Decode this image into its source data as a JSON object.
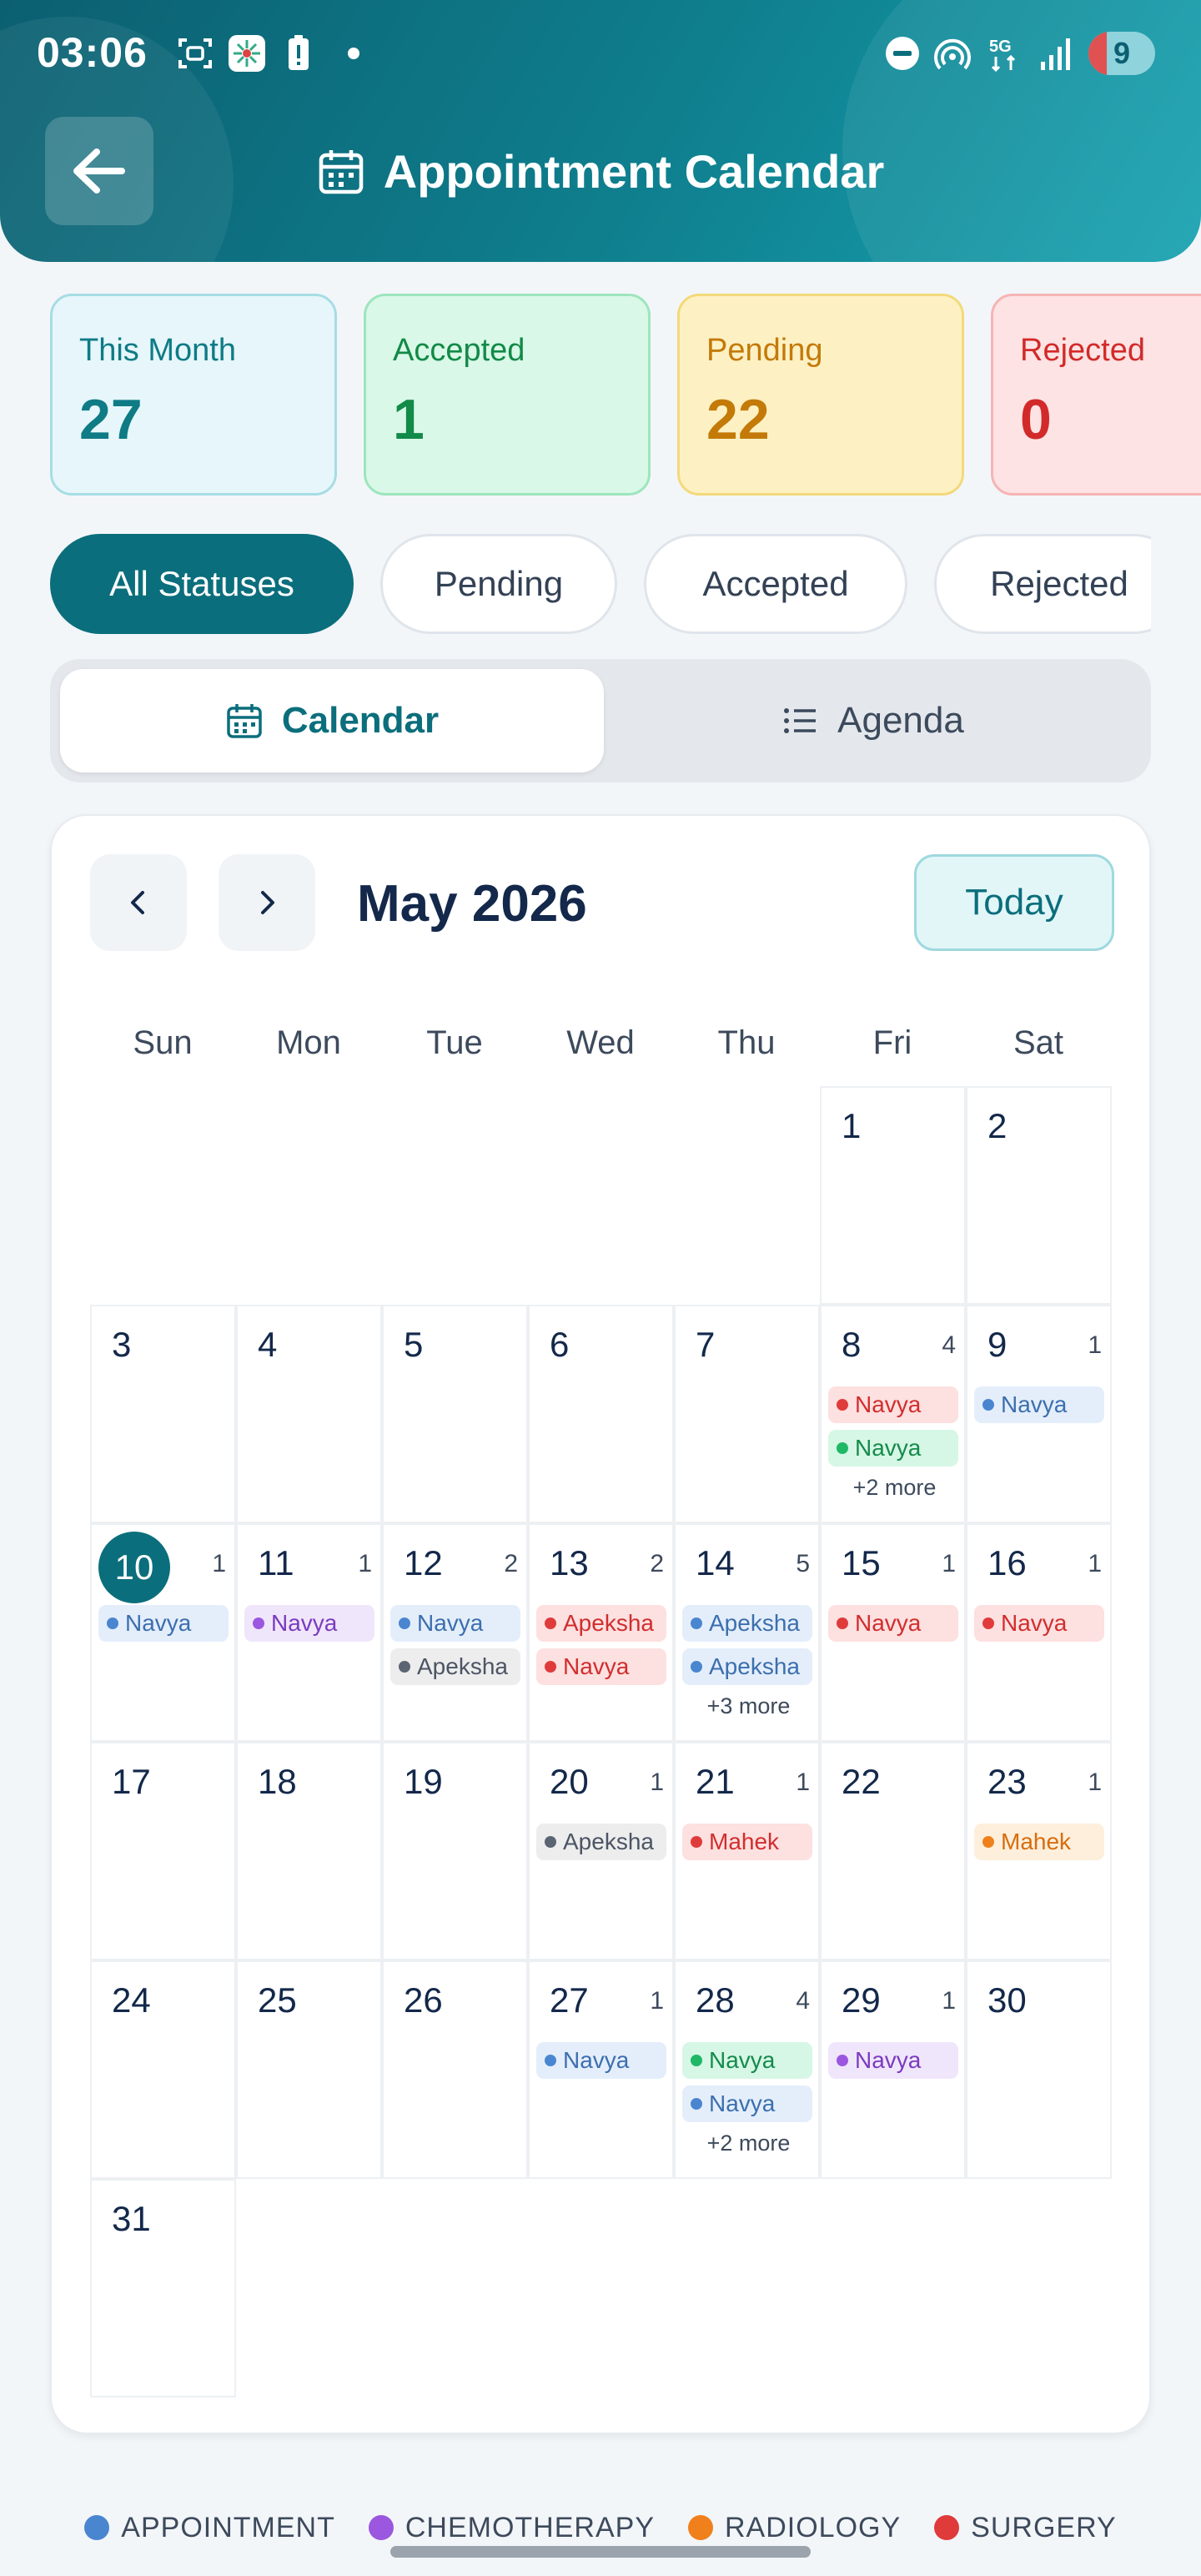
{
  "status_bar": {
    "time": "03:06",
    "battery": "9"
  },
  "header": {
    "title": "Appointment Calendar"
  },
  "stats": [
    {
      "label": "This Month",
      "value": "27"
    },
    {
      "label": "Accepted",
      "value": "1"
    },
    {
      "label": "Pending",
      "value": "22"
    },
    {
      "label": "Rejected",
      "value": "0"
    }
  ],
  "filters": [
    "All Statuses",
    "Pending",
    "Accepted",
    "Rejected"
  ],
  "view_toggle": {
    "calendar": "Calendar",
    "agenda": "Agenda"
  },
  "calendar": {
    "month": "May 2026",
    "today_label": "Today",
    "weekdays": [
      "Sun",
      "Mon",
      "Tue",
      "Wed",
      "Thu",
      "Fri",
      "Sat"
    ],
    "today": 10,
    "days": [
      {
        "day": 1,
        "count": "",
        "events": [],
        "more": ""
      },
      {
        "day": 2,
        "count": "",
        "events": [],
        "more": ""
      },
      {
        "day": 3,
        "count": "",
        "events": [],
        "more": ""
      },
      {
        "day": 4,
        "count": "",
        "events": [],
        "more": ""
      },
      {
        "day": 5,
        "count": "",
        "events": [],
        "more": ""
      },
      {
        "day": 6,
        "count": "",
        "events": [],
        "more": ""
      },
      {
        "day": 7,
        "count": "",
        "events": [],
        "more": ""
      },
      {
        "day": 8,
        "count": "4",
        "events": [
          {
            "name": "Navya",
            "color": "red"
          },
          {
            "name": "Navya",
            "color": "green"
          }
        ],
        "more": "+2 more"
      },
      {
        "day": 9,
        "count": "1",
        "events": [
          {
            "name": "Navya",
            "color": "blue"
          }
        ],
        "more": ""
      },
      {
        "day": 10,
        "count": "1",
        "events": [
          {
            "name": "Navya",
            "color": "blue"
          }
        ],
        "more": ""
      },
      {
        "day": 11,
        "count": "1",
        "events": [
          {
            "name": "Navya",
            "color": "purple"
          }
        ],
        "more": ""
      },
      {
        "day": 12,
        "count": "2",
        "events": [
          {
            "name": "Navya",
            "color": "blue"
          },
          {
            "name": "Apeksha",
            "color": "gray"
          }
        ],
        "more": ""
      },
      {
        "day": 13,
        "count": "2",
        "events": [
          {
            "name": "Apeksha",
            "color": "red"
          },
          {
            "name": "Navya",
            "color": "red"
          }
        ],
        "more": ""
      },
      {
        "day": 14,
        "count": "5",
        "events": [
          {
            "name": "Apeksha",
            "color": "blue"
          },
          {
            "name": "Apeksha",
            "color": "blue"
          }
        ],
        "more": "+3 more"
      },
      {
        "day": 15,
        "count": "1",
        "events": [
          {
            "name": "Navya",
            "color": "red"
          }
        ],
        "more": ""
      },
      {
        "day": 16,
        "count": "1",
        "events": [
          {
            "name": "Navya",
            "color": "red"
          }
        ],
        "more": ""
      },
      {
        "day": 17,
        "count": "",
        "events": [],
        "more": ""
      },
      {
        "day": 18,
        "count": "",
        "events": [],
        "more": ""
      },
      {
        "day": 19,
        "count": "",
        "events": [],
        "more": ""
      },
      {
        "day": 20,
        "count": "1",
        "events": [
          {
            "name": "Apeksha",
            "color": "gray"
          }
        ],
        "more": ""
      },
      {
        "day": 21,
        "count": "1",
        "events": [
          {
            "name": "Mahek",
            "color": "red"
          }
        ],
        "more": ""
      },
      {
        "day": 22,
        "count": "",
        "events": [],
        "more": ""
      },
      {
        "day": 23,
        "count": "1",
        "events": [
          {
            "name": "Mahek",
            "color": "orange"
          }
        ],
        "more": ""
      },
      {
        "day": 24,
        "count": "",
        "events": [],
        "more": ""
      },
      {
        "day": 25,
        "count": "",
        "events": [],
        "more": ""
      },
      {
        "day": 26,
        "count": "",
        "events": [],
        "more": ""
      },
      {
        "day": 27,
        "count": "1",
        "events": [
          {
            "name": "Navya",
            "color": "blue"
          }
        ],
        "more": ""
      },
      {
        "day": 28,
        "count": "4",
        "events": [
          {
            "name": "Navya",
            "color": "green"
          },
          {
            "name": "Navya",
            "color": "blue"
          }
        ],
        "more": "+2 more"
      },
      {
        "day": 29,
        "count": "1",
        "events": [
          {
            "name": "Navya",
            "color": "purple"
          }
        ],
        "more": ""
      },
      {
        "day": 30,
        "count": "",
        "events": [],
        "more": ""
      },
      {
        "day": 31,
        "count": "",
        "events": [],
        "more": ""
      }
    ]
  },
  "legend": [
    {
      "label": "APPOINTMENT",
      "color": "#4a86d0"
    },
    {
      "label": "CHEMOTHERAPY",
      "color": "#9b57e0"
    },
    {
      "label": "RADIOLOGY",
      "color": "#f0801b"
    },
    {
      "label": "SURGERY",
      "color": "#e03b3b"
    }
  ],
  "colors": {
    "primary": "#0b6e7c",
    "header_start": "#0b5f70",
    "header_end": "#17a2b0"
  }
}
